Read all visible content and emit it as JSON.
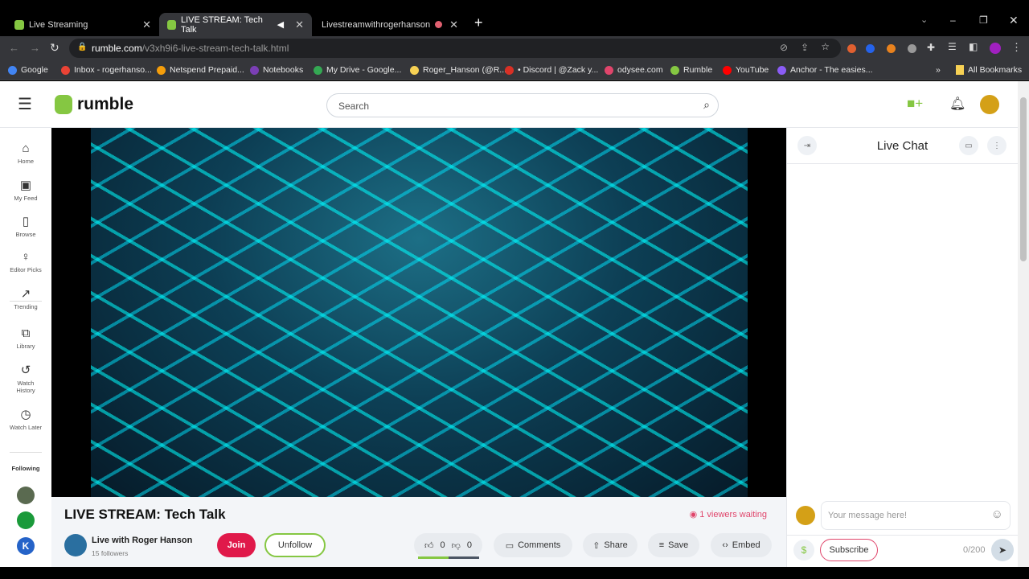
{
  "browser": {
    "tabs": [
      {
        "label": "Live Streaming"
      },
      {
        "label": "LIVE STREAM: Tech Talk"
      },
      {
        "label": "Livestreamwithrogerhanson"
      }
    ],
    "url_domain": "rumble.com",
    "url_path": "/v3xh9i6-live-stream-tech-talk.html",
    "bookmarks": [
      {
        "label": "Google",
        "color": "#4285f4"
      },
      {
        "label": "Inbox - rogerhanso...",
        "color": "#ea4335"
      },
      {
        "label": "Netspend Prepaid...",
        "color": "#f59e0b"
      },
      {
        "label": "Notebooks",
        "color": "#7b3fb5"
      },
      {
        "label": "My Drive - Google...",
        "color": "#34a853"
      },
      {
        "label": "Roger_Hanson (@R...",
        "color": "#f7d154"
      },
      {
        "label": "• Discord | @Zack y...",
        "color": "#d93025"
      },
      {
        "label": "odysee.com",
        "color": "#e0456b"
      },
      {
        "label": "Rumble",
        "color": "#85c742"
      },
      {
        "label": "YouTube",
        "color": "#ff0000"
      },
      {
        "label": "Anchor - The easies...",
        "color": "#8b5cf6"
      }
    ],
    "all_bookmarks": "All Bookmarks"
  },
  "header": {
    "logo": "rumble",
    "search_placeholder": "Search",
    "brand_color": "#85c742"
  },
  "sidebar": {
    "items": [
      {
        "label": "Home",
        "icon": "⌂"
      },
      {
        "label": "My Feed",
        "icon": "▣"
      },
      {
        "label": "Browse",
        "icon": "▯"
      },
      {
        "label": "Editor Picks",
        "icon": "♀"
      },
      {
        "label": "Trending",
        "icon": "↗"
      },
      {
        "label": "Library",
        "icon": "⧉"
      },
      {
        "label": "Watch History",
        "icon": "↺"
      },
      {
        "label": "Watch Later",
        "icon": "◷"
      }
    ],
    "following_label": "Following"
  },
  "video": {
    "title": "LIVE STREAM: Tech Talk",
    "viewers": "1 viewers waiting",
    "channel": "Live with Roger Hanson",
    "followers": "15 followers",
    "join": "Join",
    "unfollow": "Unfollow",
    "likes": "0",
    "dislikes": "0",
    "comments": "Comments",
    "share": "Share",
    "save": "Save",
    "embed": "Embed"
  },
  "chat": {
    "title": "Live Chat",
    "placeholder": "Your message here!",
    "subscribe": "Subscribe",
    "counter": "0/200"
  }
}
